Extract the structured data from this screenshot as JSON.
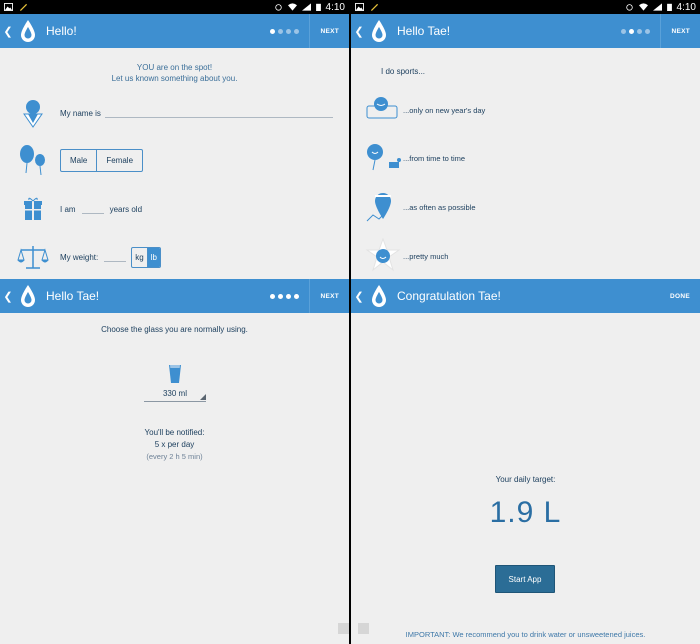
{
  "status": {
    "time": "4:10"
  },
  "colors": {
    "accent": "#3e8fd0",
    "button": "#2b6d96"
  },
  "screen1": {
    "title": "Hello!",
    "next_label": "NEXT",
    "intro_line1": "YOU are on the spot!",
    "intro_line2": "Let us known something about you.",
    "name_label": "My name is",
    "gender_options": [
      "Male",
      "Female"
    ],
    "age_prefix": "I am",
    "age_suffix": "years old",
    "weight_label": "My weight:",
    "weight_units": [
      "kg",
      "lb"
    ],
    "weight_unit_selected": "lb",
    "page_index": 0
  },
  "screen2": {
    "title": "Hello Tae!",
    "next_label": "NEXT",
    "heading": "I do sports...",
    "options": [
      "...only on new year's day",
      "...from time to time",
      "...as often as possible",
      "...pretty much"
    ],
    "page_index": 1
  },
  "screen3": {
    "title": "Hello Tae!",
    "next_label": "NEXT",
    "question": "Choose the glass you are normally using.",
    "glass_value": "330 ml",
    "notify_heading": "You'll be notified:",
    "notify_freq": "5 x per day",
    "notify_interval": "(every 2 h 5 min)",
    "page_index": 3
  },
  "screen4": {
    "title": "Congratulation Tae!",
    "done_label": "DONE",
    "target_label": "Your daily target:",
    "target_value": "1.9 L",
    "start_label": "Start App",
    "important": "IMPORTANT: We recommend you to drink water or unsweetened juices."
  },
  "icons": {
    "back": "chevron-left-icon",
    "logo": "water-drop-icon"
  }
}
